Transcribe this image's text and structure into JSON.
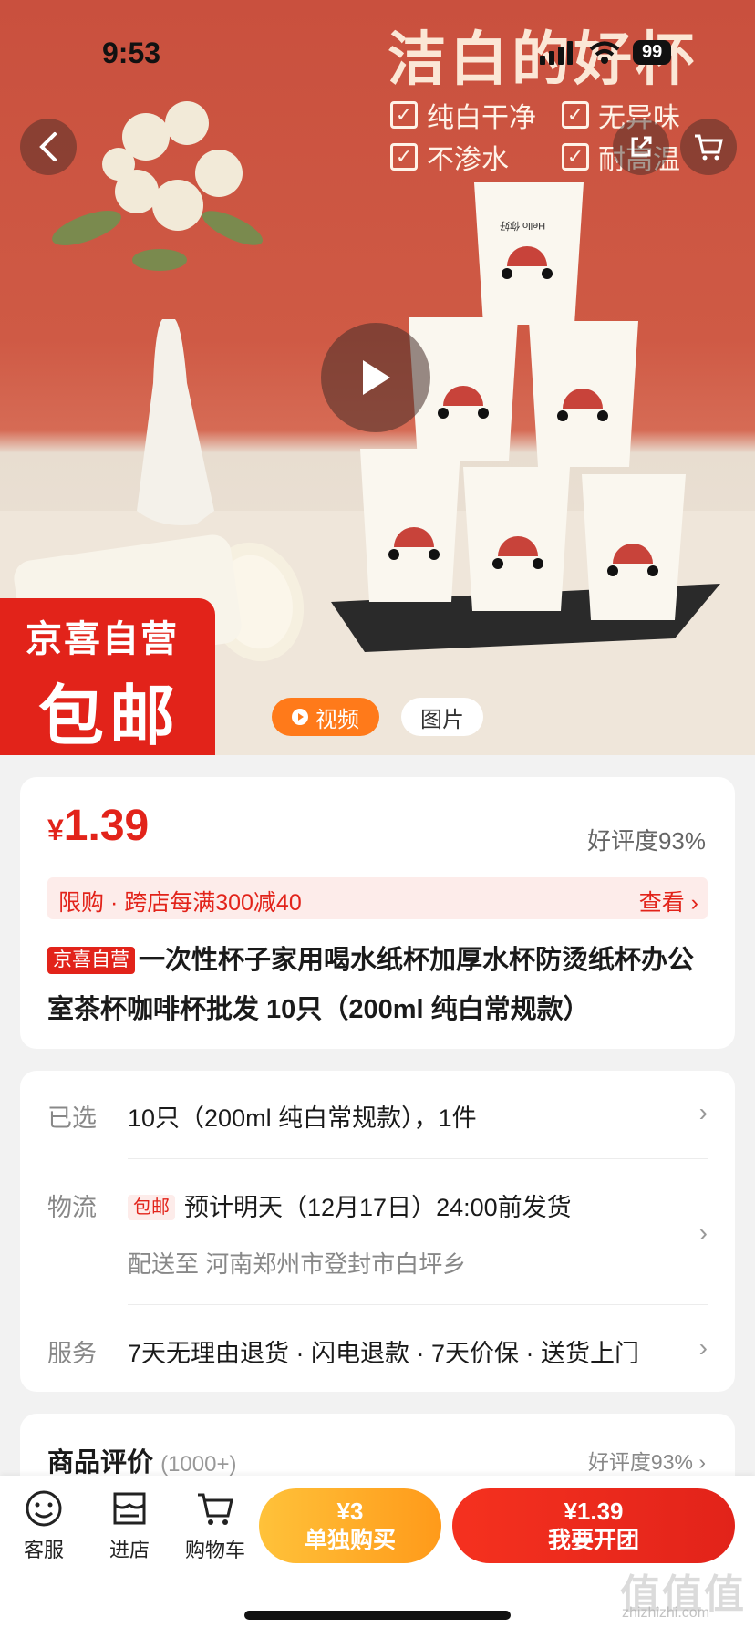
{
  "status_bar": {
    "time": "9:53",
    "battery": "99"
  },
  "hero": {
    "banner_title": "洁白的好杯",
    "features": [
      "纯白干净",
      "无异味",
      "不渗水",
      "耐高温"
    ],
    "cup_print": "Hello 你好",
    "badge_line1": "京喜自营",
    "badge_line2": "包邮",
    "tab_video": "视频",
    "tab_photo": "图片"
  },
  "product": {
    "currency": "¥",
    "price": "1.39",
    "rating": "好评度93%",
    "promo_text": "限购 · 跨店每满300减40",
    "promo_view": "查看 ›",
    "title_tag": "京喜自营",
    "title": "一次性杯子家用喝水纸杯加厚水杯防烫纸杯办公室茶杯咖啡杯批发 10只（200ml 纯白常规款）"
  },
  "details": {
    "selected_label": "已选",
    "selected_value": "10只（200ml 纯白常规款），1件",
    "logistics_label": "物流",
    "logistics_tag": "包邮",
    "logistics_value": "预计明天（12月17日）24:00前发货",
    "delivery_to": "配送至 河南郑州市登封市白坪乡",
    "service_label": "服务",
    "service_value": "7天无理由退货 · 闪电退款 · 7天价保 · 送货上门"
  },
  "reviews": {
    "title": "商品评价",
    "count": "(1000+)",
    "rating": "好评度93% ›"
  },
  "bottom_bar": {
    "service": "客服",
    "store": "进店",
    "cart": "购物车",
    "solo_price": "¥3",
    "solo_label": "单独购买",
    "group_price": "¥1.39",
    "group_label": "我要开团"
  },
  "watermark": {
    "main": "值值值",
    "url": "zhizhizhi.com"
  },
  "colors": {
    "accent_red": "#e2231a",
    "orange": "#ff7a1a",
    "hero_bg": "#c9503e"
  }
}
